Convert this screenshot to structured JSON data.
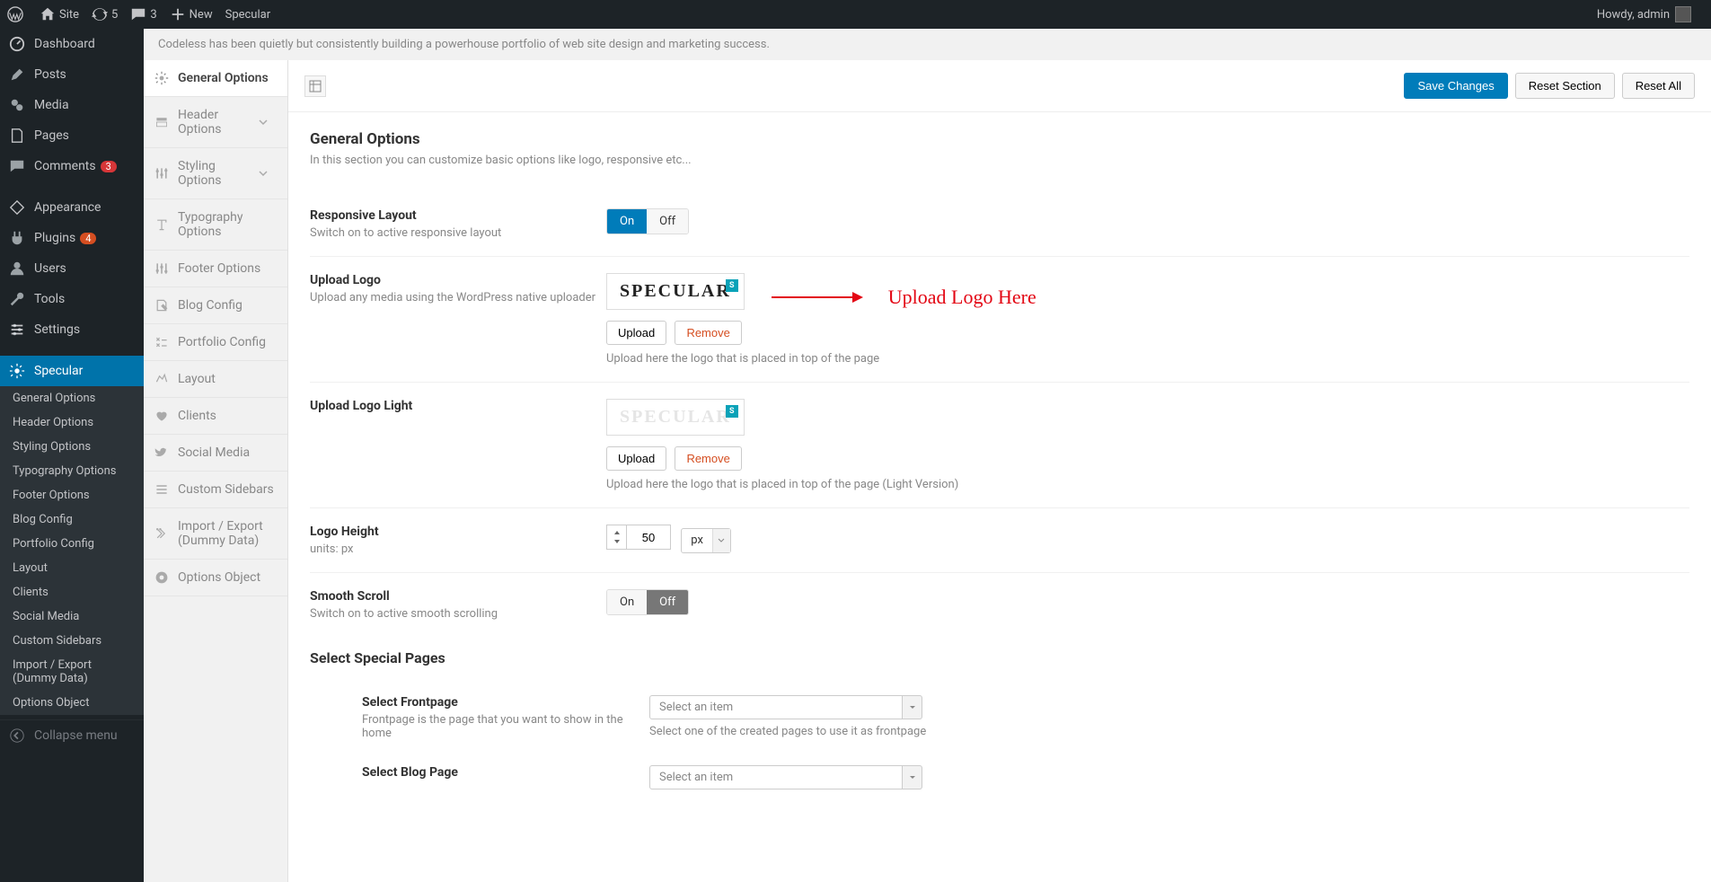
{
  "adminbar": {
    "site": "Site",
    "updates_count": "5",
    "comments_count": "3",
    "new": "New",
    "specular": "Specular",
    "howdy": "Howdy, admin"
  },
  "wp_sidebar": {
    "items": [
      {
        "label": "Dashboard"
      },
      {
        "label": "Posts"
      },
      {
        "label": "Media"
      },
      {
        "label": "Pages"
      },
      {
        "label": "Comments",
        "badge": "3"
      },
      {
        "label": "Appearance"
      },
      {
        "label": "Plugins",
        "badge": "4"
      },
      {
        "label": "Users"
      },
      {
        "label": "Tools"
      },
      {
        "label": "Settings"
      },
      {
        "label": "Specular"
      }
    ],
    "sub_items": [
      "General Options",
      "Header Options",
      "Styling Options",
      "Typography Options",
      "Footer Options",
      "Blog Config",
      "Portfolio Config",
      "Layout",
      "Clients",
      "Social Media",
      "Custom Sidebars",
      "Import / Export (Dummy Data)",
      "Options Object"
    ],
    "collapse": "Collapse menu"
  },
  "codeless_strip": "Codeless has been quietly but consistently building a powerhouse portfolio of web site design and marketing success.",
  "opt_sidebar": {
    "items": [
      "General Options",
      "Header Options",
      "Styling Options",
      "Typography Options",
      "Footer Options",
      "Blog Config",
      "Portfolio Config",
      "Layout",
      "Clients",
      "Social Media",
      "Custom Sidebars",
      "Import / Export (Dummy Data)",
      "Options Object"
    ]
  },
  "toolbar": {
    "save": "Save Changes",
    "reset_section": "Reset Section",
    "reset_all": "Reset All"
  },
  "section": {
    "title": "General Options",
    "desc": "In this section you can customize basic options like logo, responsive etc..."
  },
  "fields": {
    "responsive": {
      "title": "Responsive Layout",
      "desc": "Switch on to active responsive layout",
      "on": "On",
      "off": "Off"
    },
    "upload_logo": {
      "title": "Upload Logo",
      "desc": "Upload any media using the WordPress native uploader",
      "logo_text": "SPECULAR",
      "upload_btn": "Upload",
      "remove_btn": "Remove",
      "hint": "Upload here the logo that is placed in top of the page"
    },
    "upload_logo_light": {
      "title": "Upload Logo Light",
      "logo_text": "SPECULAR",
      "upload_btn": "Upload",
      "remove_btn": "Remove",
      "hint": "Upload here the logo that is placed in top of the page (Light Version)"
    },
    "logo_height": {
      "title": "Logo Height",
      "desc": "units: px",
      "value": "50",
      "unit": "px"
    },
    "smooth_scroll": {
      "title": "Smooth Scroll",
      "desc": "Switch on to active smooth scrolling",
      "on": "On",
      "off": "Off"
    }
  },
  "special": {
    "title": "Select Special Pages",
    "frontpage": {
      "title": "Select Frontpage",
      "desc": "Frontpage is the page that you want to show in the home",
      "placeholder": "Select an item",
      "hint": "Select one of the created pages to use it as frontpage"
    },
    "blogpage": {
      "title": "Select Blog Page",
      "placeholder": "Select an item"
    }
  },
  "annotation": {
    "text": "Upload Logo Here"
  }
}
